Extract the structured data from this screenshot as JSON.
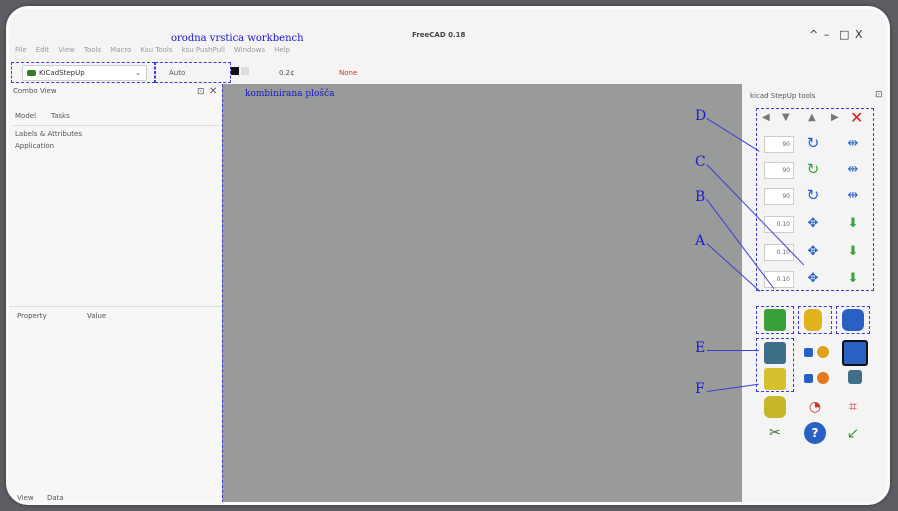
{
  "window": {
    "title": "FreeCAD 0.18",
    "controls": [
      "^",
      "–",
      "□",
      "X"
    ]
  },
  "annotations": {
    "workbench_toolbar": "orodna vrstica workbench",
    "combo_area": "kombinirana ploŝča",
    "letters": [
      "D",
      "C",
      "B",
      "A",
      "E",
      "F"
    ]
  },
  "menu": [
    "File",
    "Edit",
    "View",
    "Tools",
    "Macro",
    "Ksu Tools",
    "ksu PushPull",
    "Windows",
    "Help"
  ],
  "toolbar": {
    "workbench": "KiCadStepUp",
    "auto": "Auto",
    "line_width": "0.2¢",
    "none": "None"
  },
  "left_panel": {
    "title": "Combo View",
    "tabs": [
      "Model",
      "Tasks"
    ],
    "tree": [
      "Labels & Attributes",
      "Application"
    ],
    "prop_headers": [
      "Property",
      "Value"
    ],
    "bottom_tabs": [
      "View",
      "Data"
    ]
  },
  "right_panel": {
    "title": "kicad StepUp tools",
    "values": [
      "90",
      "90",
      "90",
      "0.10",
      "0.10",
      "0.10"
    ],
    "colors": {
      "red": "#d32020",
      "blue": "#2a5fc4",
      "green": "#3aa03a",
      "yellow": "#e2b21c"
    }
  }
}
